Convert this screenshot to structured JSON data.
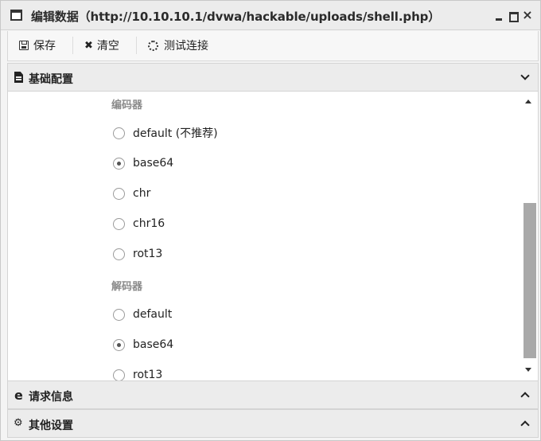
{
  "window": {
    "title": "编辑数据（http://10.10.10.1/dvwa/hackable/uploads/shell.php）",
    "minimize_icon": "minimize-icon",
    "maximize_icon": "maximize-icon",
    "close_label": "×"
  },
  "toolbar": {
    "save_label": "保存",
    "clear_label": "清空",
    "test_label": "测试连接",
    "clear_glyph": "✖"
  },
  "sections": {
    "basic": "基础配置",
    "request": "请求信息",
    "other": "其他设置",
    "request_icon_glyph": "e",
    "other_icon_glyph": "⚙"
  },
  "encoder": {
    "label": "编码器",
    "options": [
      {
        "label": "default (不推荐)",
        "checked": false
      },
      {
        "label": "base64",
        "checked": true
      },
      {
        "label": "chr",
        "checked": false
      },
      {
        "label": "chr16",
        "checked": false
      },
      {
        "label": "rot13",
        "checked": false
      }
    ]
  },
  "decoder": {
    "label": "解码器",
    "options": [
      {
        "label": "default",
        "checked": false
      },
      {
        "label": "base64",
        "checked": true
      },
      {
        "label": "rot13",
        "checked": false
      }
    ]
  }
}
